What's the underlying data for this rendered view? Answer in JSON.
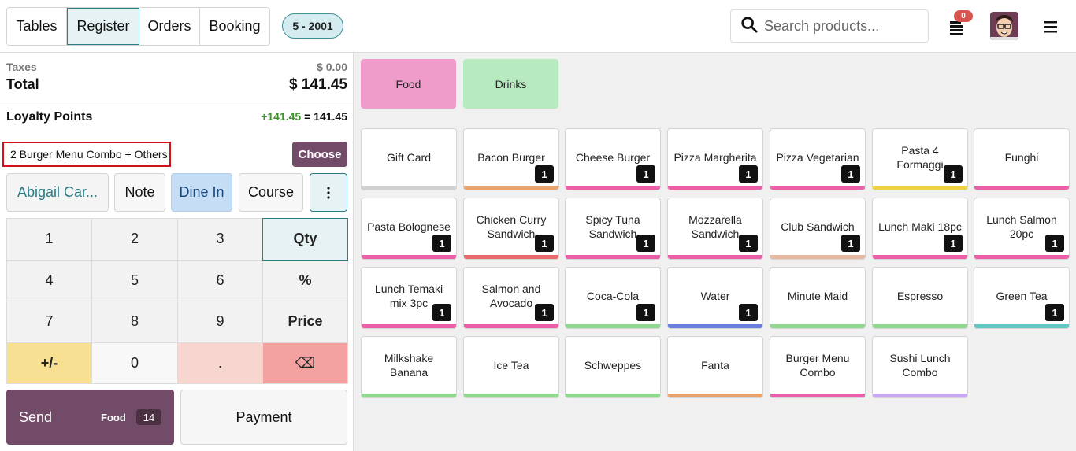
{
  "nav": {
    "tabs": [
      {
        "label": "Tables"
      },
      {
        "label": "Register"
      },
      {
        "label": "Orders"
      },
      {
        "label": "Booking"
      }
    ],
    "table_badge": "5 - 2001",
    "search_placeholder": "Search products...",
    "notification_count": "0"
  },
  "order": {
    "taxes_label": "Taxes",
    "taxes_value": "$ 0.00",
    "total_label": "Total",
    "total_value": "$ 141.45",
    "loyalty_label": "Loyalty Points",
    "loyalty_plus": "+141.45",
    "loyalty_eq": " = 141.45",
    "reward_text": "2 Burger Menu Combo + Others",
    "choose_label": "Choose"
  },
  "actions": {
    "customer": "Abigail Car...",
    "note": "Note",
    "dine_in": "Dine In",
    "course": "Course"
  },
  "numpad": [
    "1",
    "2",
    "3",
    "Qty",
    "4",
    "5",
    "6",
    "%",
    "7",
    "8",
    "9",
    "Price",
    "+/-",
    "0",
    ".",
    "⌫"
  ],
  "send": {
    "label": "Send",
    "category": "Food",
    "count": "14"
  },
  "payment_label": "Payment",
  "categories": [
    {
      "label": "Food",
      "color": "#f09ccb"
    },
    {
      "label": "Drinks",
      "color": "#b8eac0"
    }
  ],
  "products": [
    {
      "name": "Gift Card",
      "bar": "#d0d0d0",
      "qty": ""
    },
    {
      "name": "Bacon Burger",
      "bar": "#e8a26a",
      "qty": "1"
    },
    {
      "name": "Cheese Burger",
      "bar": "#ec5fa8",
      "qty": "1"
    },
    {
      "name": "Pizza Margherita",
      "bar": "#ec5fa8",
      "qty": "1"
    },
    {
      "name": "Pizza Vegetarian",
      "bar": "#ec5fa8",
      "qty": "1"
    },
    {
      "name": "Pasta 4 Formaggi",
      "bar": "#f0d040",
      "qty": "1"
    },
    {
      "name": "Funghi",
      "bar": "#ec5fa8",
      "qty": ""
    },
    {
      "name": "Pasta Bolognese",
      "bar": "#ec5fa8",
      "qty": "1"
    },
    {
      "name": "Chicken Curry Sandwich",
      "bar": "#e86a6a",
      "qty": "1"
    },
    {
      "name": "Spicy Tuna Sandwich",
      "bar": "#ec5fa8",
      "qty": "1"
    },
    {
      "name": "Mozzarella Sandwich",
      "bar": "#ec5fa8",
      "qty": "1"
    },
    {
      "name": "Club Sandwich",
      "bar": "#e8b8a0",
      "qty": "1"
    },
    {
      "name": "Lunch Maki 18pc",
      "bar": "#ec5fa8",
      "qty": "1"
    },
    {
      "name": "Lunch Salmon 20pc",
      "bar": "#ec5fa8",
      "qty": "1"
    },
    {
      "name": "Lunch Temaki mix 3pc",
      "bar": "#ec5fa8",
      "qty": "1"
    },
    {
      "name": "Salmon and Avocado",
      "bar": "#ec5fa8",
      "qty": "1"
    },
    {
      "name": "Coca-Cola",
      "bar": "#90d890",
      "qty": "1"
    },
    {
      "name": "Water",
      "bar": "#6a7ee0",
      "qty": "1"
    },
    {
      "name": "Minute Maid",
      "bar": "#90d890",
      "qty": ""
    },
    {
      "name": "Espresso",
      "bar": "#90d890",
      "qty": ""
    },
    {
      "name": "Green Tea",
      "bar": "#60c8c0",
      "qty": "1"
    },
    {
      "name": "Milkshake Banana",
      "bar": "#90d890",
      "qty": ""
    },
    {
      "name": "Ice Tea",
      "bar": "#90d890",
      "qty": ""
    },
    {
      "name": "Schweppes",
      "bar": "#90d890",
      "qty": ""
    },
    {
      "name": "Fanta",
      "bar": "#e8a26a",
      "qty": ""
    },
    {
      "name": "Burger Menu Combo",
      "bar": "#ec5fa8",
      "qty": ""
    },
    {
      "name": "Sushi Lunch Combo",
      "bar": "#c8a8f0",
      "qty": ""
    }
  ]
}
